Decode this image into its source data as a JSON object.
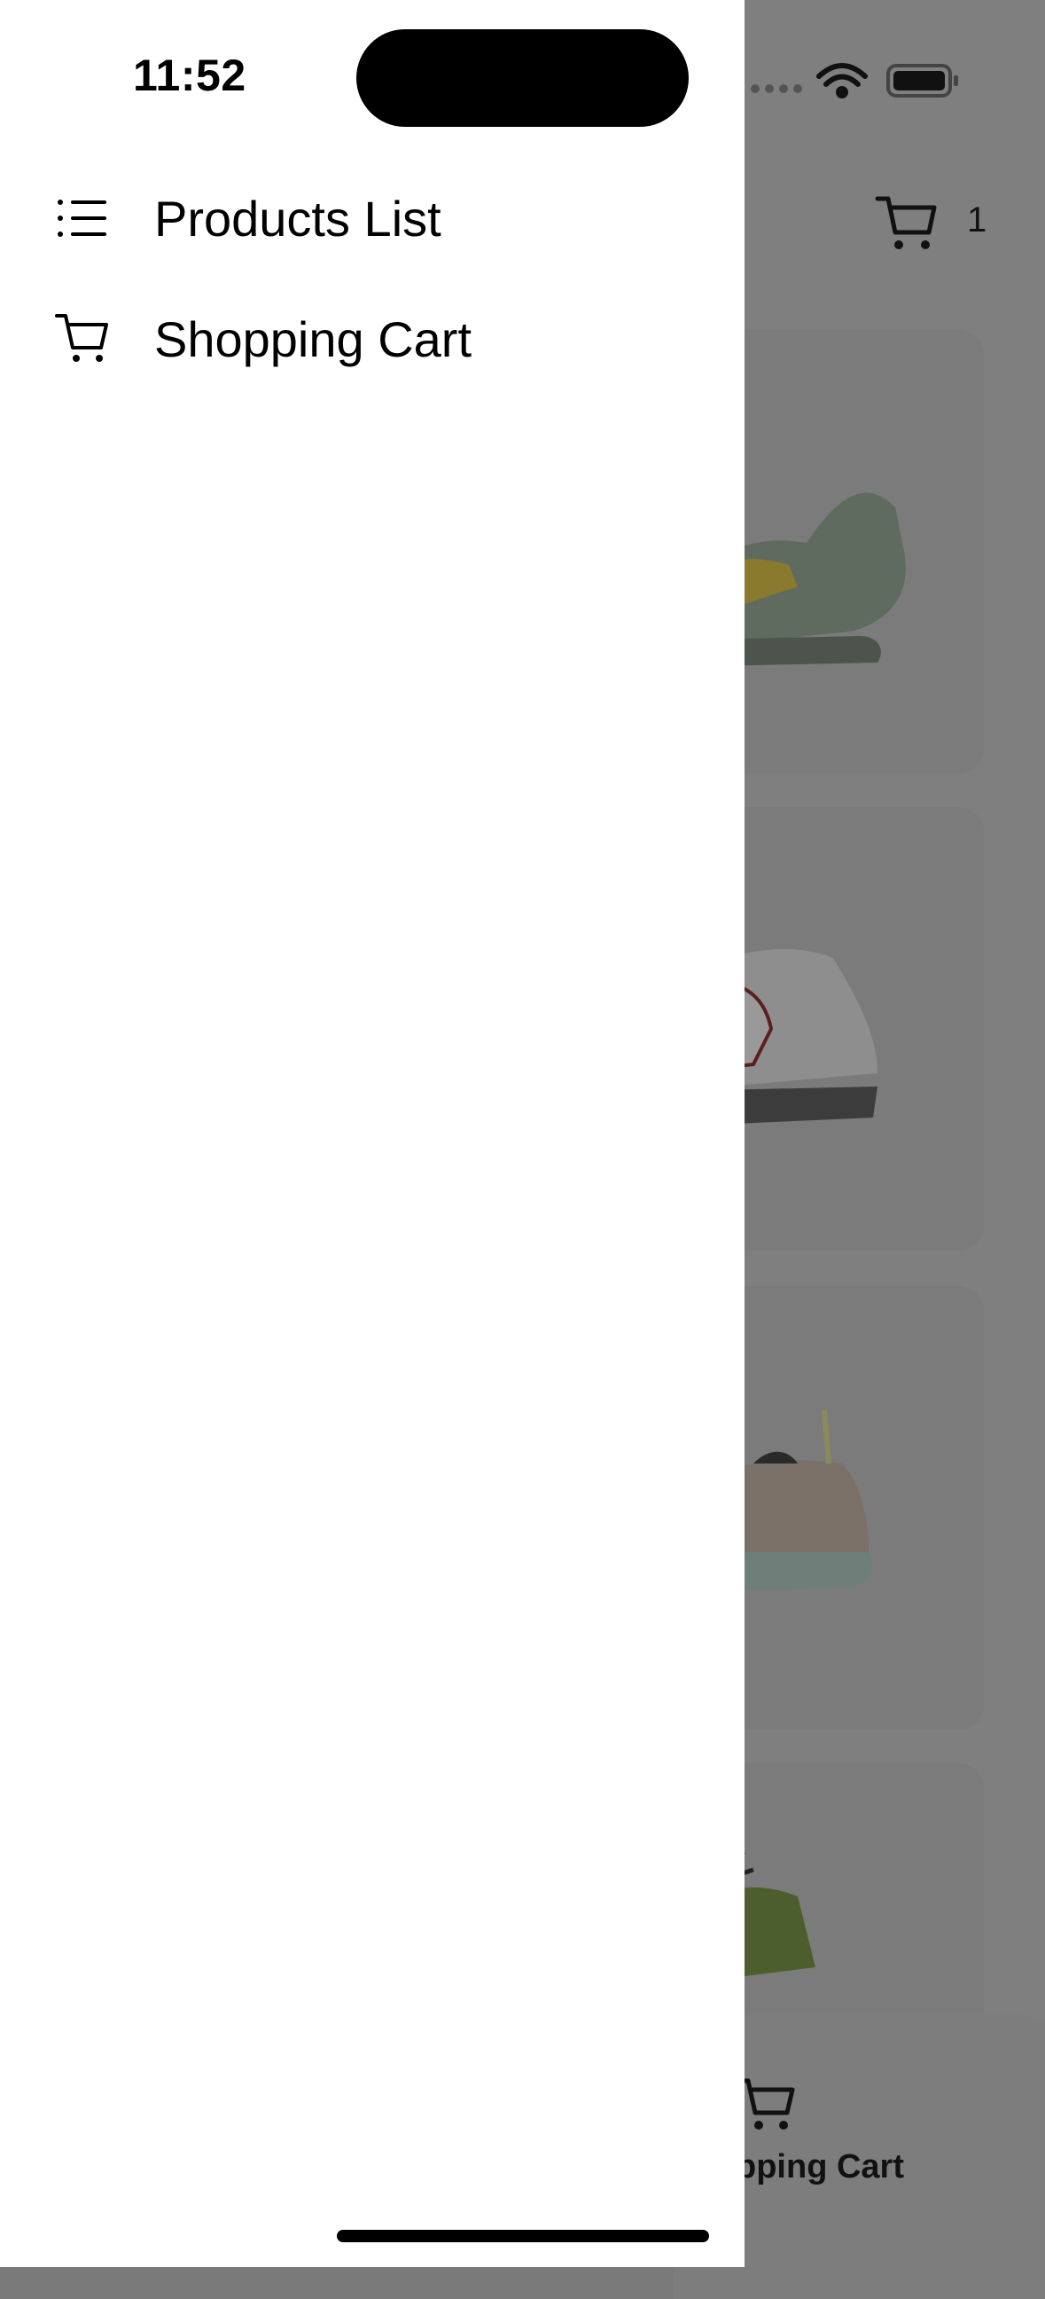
{
  "status_bar": {
    "time": "11:52",
    "icons": [
      "signal-icon",
      "wifi-icon",
      "battery-icon"
    ]
  },
  "drawer": {
    "items": [
      {
        "label": "Products List",
        "icon": "list-icon"
      },
      {
        "label": "Shopping Cart",
        "icon": "cart-icon"
      }
    ]
  },
  "background": {
    "cart_count": "1",
    "bottom_tab_label": "Shopping Cart",
    "overlay_color": "#7f7f7f"
  }
}
